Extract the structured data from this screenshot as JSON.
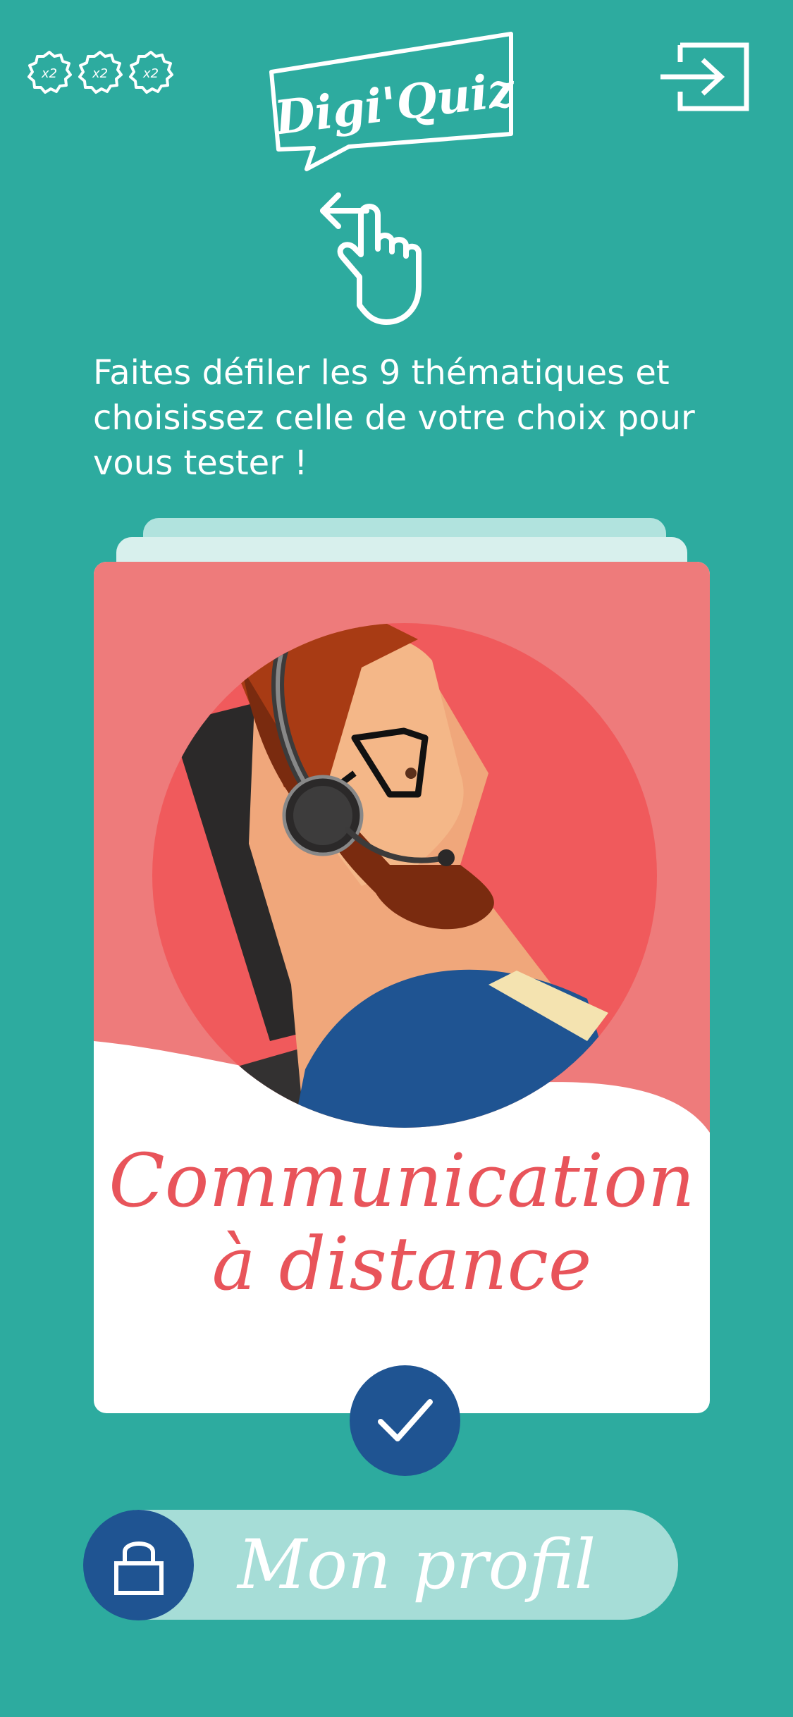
{
  "header": {
    "badges": [
      {
        "label": "x2",
        "icon": "multiplier-badge-icon"
      },
      {
        "label": "x2",
        "icon": "multiplier-badge-icon"
      },
      {
        "label": "x2",
        "icon": "multiplier-badge-icon"
      }
    ],
    "logo_text": "Digi'Quiz",
    "exit_icon": "logout-icon"
  },
  "instruction": {
    "icon": "swipe-left-hand-icon",
    "text": "Faites défiler les 9 thématiques et choisissez celle de votre choix pour vous tester !"
  },
  "card": {
    "title_line1": "Communication",
    "title_line2": "à distance",
    "illustration": "call-center-agent-illustration",
    "confirm_icon": "checkmark-icon"
  },
  "profile": {
    "label": "Mon profil",
    "icon": "lock-icon"
  },
  "colors": {
    "background": "#2dab9f",
    "card_accent": "#e8545a",
    "button_blue": "#1f5492",
    "pill": "#a6ddd7"
  }
}
